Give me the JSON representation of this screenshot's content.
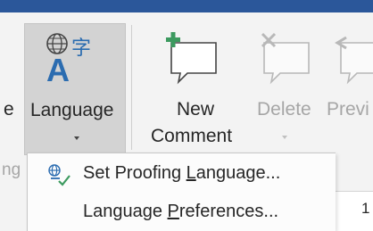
{
  "ribbon": {
    "partial_left_label": "e",
    "language_label": "Language",
    "new_comment_line1": "New",
    "new_comment_line2": "Comment",
    "delete_label": "Delete",
    "previous_label": "Previ",
    "partial_lower_left": "ng"
  },
  "language_menu": {
    "items": [
      {
        "label_before": "Set Proofing ",
        "access_key": "L",
        "label_after": "anguage...",
        "icon": "proofing-language-icon"
      },
      {
        "label_before": "Language ",
        "access_key": "P",
        "label_after": "references...",
        "icon": null
      }
    ]
  },
  "right_edge_text": "1",
  "colors": {
    "title_bar": "#2b579a",
    "ribbon_bg": "#f3f3f3",
    "button_highlight": "#d3d3d3",
    "accent_green": "#3c9a5f",
    "accent_blue": "#2b6cb0"
  },
  "icons": {
    "language": "language-translate-icon",
    "new_comment": "new-comment-icon",
    "delete_comment": "delete-comment-icon",
    "previous_comment": "previous-comment-icon"
  }
}
